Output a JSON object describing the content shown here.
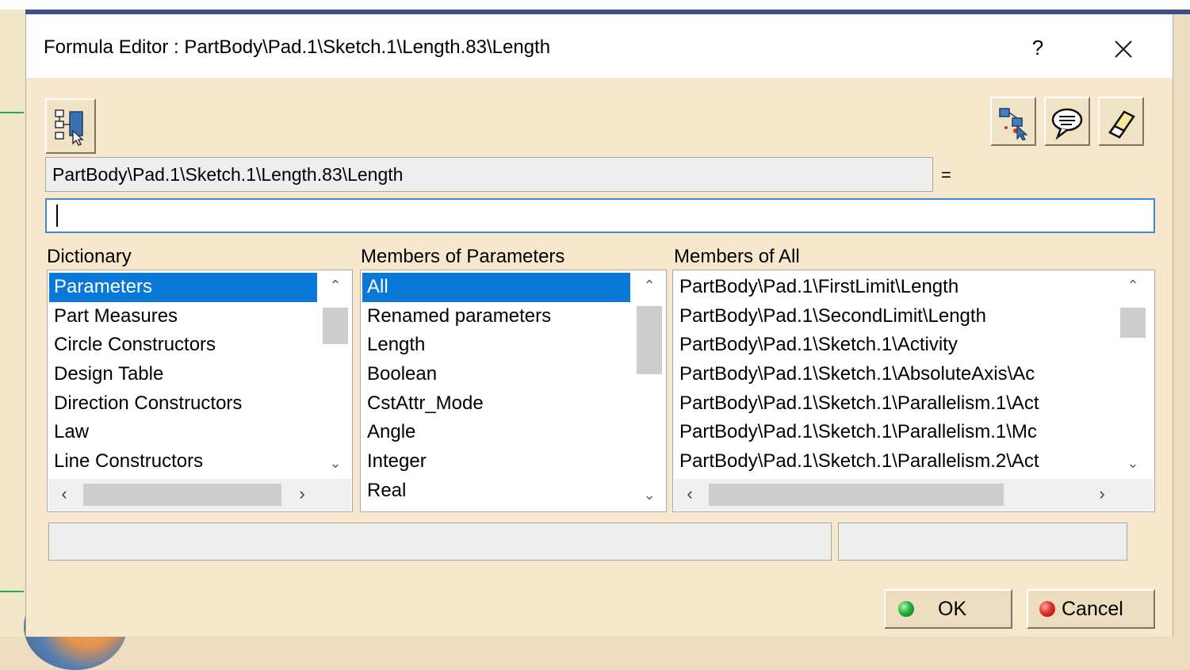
{
  "window": {
    "title": "Formula Editor : PartBody\\Pad.1\\Sketch.1\\Length.83\\Length",
    "help_label": "?"
  },
  "formula": {
    "parameter_path": "PartBody\\Pad.1\\Sketch.1\\Length.83\\Length",
    "equals": "=",
    "expression_value": ""
  },
  "dictionary": {
    "header": "Dictionary",
    "items": [
      "Parameters",
      "Part Measures",
      "Circle Constructors",
      "Design Table",
      "Direction Constructors",
      "Law",
      "Line Constructors"
    ],
    "selected_index": 0
  },
  "members_of_parameters": {
    "header": "Members of Parameters",
    "items": [
      "All",
      "Renamed parameters",
      "Length",
      "Boolean",
      "CstAttr_Mode",
      "Angle",
      "Integer",
      "Real"
    ],
    "selected_index": 0
  },
  "members_of_all": {
    "header": "Members of All",
    "items": [
      "PartBody\\Pad.1\\FirstLimit\\Length",
      "PartBody\\Pad.1\\SecondLimit\\Length",
      "PartBody\\Pad.1\\Sketch.1\\Activity",
      "PartBody\\Pad.1\\Sketch.1\\AbsoluteAxis\\Ac",
      "PartBody\\Pad.1\\Sketch.1\\Parallelism.1\\Act",
      "PartBody\\Pad.1\\Sketch.1\\Parallelism.1\\Mc",
      "PartBody\\Pad.1\\Sketch.1\\Parallelism.2\\Act"
    ]
  },
  "status": {
    "main_text": "",
    "side_text": ""
  },
  "buttons": {
    "ok_label": "OK",
    "cancel_label": "Cancel"
  },
  "icons": {
    "tree": "tree-selection-icon",
    "reference": "insert-reference-icon",
    "comment": "comment-bubble-icon",
    "eraser": "eraser-icon",
    "close": "close-icon"
  },
  "colors": {
    "dialog_background": "#f7e8cd",
    "selection": "#0a78d7",
    "input_focus_border": "#3d8ad8",
    "ok_indicator": "#22b33c",
    "cancel_indicator": "#e2302a"
  }
}
